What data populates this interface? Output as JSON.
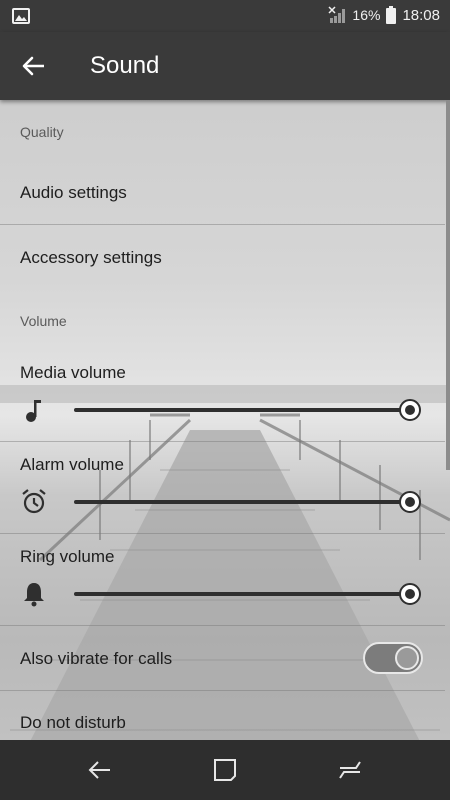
{
  "status_bar": {
    "battery_percent": "16%",
    "time": "18:08",
    "icons": [
      "image-icon",
      "signal-icon",
      "battery-icon"
    ]
  },
  "app_bar": {
    "title": "Sound",
    "back_icon": "arrow-back-icon"
  },
  "sections": {
    "quality": {
      "header": "Quality",
      "items": [
        "Audio settings",
        "Accessory settings"
      ]
    },
    "volume": {
      "header": "Volume",
      "media_volume": {
        "label": "Media volume",
        "icon": "music-note-icon",
        "level": 1.0
      },
      "alarm_volume": {
        "label": "Alarm volume",
        "icon": "alarm-clock-icon",
        "level": 1.0
      },
      "ring_volume": {
        "label": "Ring volume",
        "icon": "bell-icon",
        "level": 1.0
      },
      "vibrate": {
        "label": "Also vibrate for calls",
        "enabled": true
      },
      "do_not_disturb": {
        "label": "Do not disturb"
      }
    }
  },
  "nav_bar": {
    "buttons": [
      "back-icon",
      "home-icon",
      "recents-icon"
    ]
  },
  "colors": {
    "app_bar": "#3a3a3a",
    "nav_bar": "#2e2e2e",
    "slider": "#2f2f2f"
  }
}
